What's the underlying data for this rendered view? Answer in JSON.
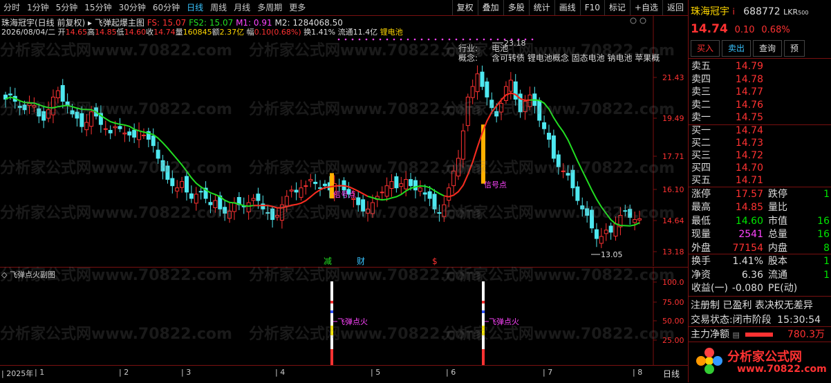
{
  "toolbar": {
    "periods": [
      "分时",
      "1分钟",
      "5分钟",
      "15分钟",
      "30分钟",
      "60分钟",
      "日线",
      "周线",
      "月线",
      "多周期",
      "更多"
    ],
    "active": "日线",
    "right_buttons": [
      "复权",
      "叠加",
      "多股",
      "统计",
      "画线",
      "F10",
      "标记",
      "+自选",
      "返回"
    ]
  },
  "title": {
    "stock": "珠海冠宇(日线 前复权)",
    "indicator": "飞弹起爆主图",
    "fs": "FS: 15.07",
    "fs2": "FS2: 15.07",
    "m1": "M1: 0.91",
    "m2": "M2: 1284068.50"
  },
  "info": {
    "date": "2026/08/04/二",
    "open_label": "开",
    "open": "14.65",
    "high_label": "高",
    "high": "14.85",
    "low_label": "低",
    "low": "14.60",
    "close_label": "收",
    "close": "14.74",
    "vol_label": "量",
    "vol": "160845",
    "amount_label": "额",
    "amount": "2.37亿",
    "change_label": "幅",
    "change": "0.10(0.68%)",
    "turnover": "换1.41%",
    "float": "流通11.4亿",
    "concept": "锂电池"
  },
  "industry": {
    "label1": "行业:",
    "value1": "电池",
    "label2": "概念:",
    "value2": "含可转债 锂电池概念 固态电池 钠电池 苹果概"
  },
  "annotations": {
    "high_price": "23.18",
    "low_price": "13.05",
    "signal1": "信号点",
    "signal2": "信号点",
    "reduce": "减",
    "finance": "财",
    "dollar": "$"
  },
  "y_axis_main": [
    "21.43",
    "19.49",
    "17.71",
    "16.10",
    "14.64",
    "13.18"
  ],
  "sub": {
    "title": "飞弹点火副图",
    "label1": "飞弹点火",
    "label2": "飞弹点火",
    "y_axis": [
      "100.0",
      "75.00",
      "50.00",
      "25.00"
    ]
  },
  "x_axis": {
    "ticks": [
      "2025年",
      "1",
      "2",
      "3",
      "4",
      "5",
      "6",
      "7",
      "8"
    ],
    "period": "日线"
  },
  "watermark": "分析家公式网www.70822.com",
  "logo": {
    "name": "分析家公式网",
    "url": "www.70822.com"
  },
  "quote": {
    "name": "珠海冠宇",
    "code": "688772",
    "tag": "LKR",
    "tag2": "500",
    "price": "14.74",
    "change": "0.10",
    "pct": "0.68%",
    "buttons": [
      "买入",
      "卖出",
      "查询",
      "预"
    ],
    "asks": [
      {
        "label": "卖五",
        "price": "14.79"
      },
      {
        "label": "卖四",
        "price": "14.78"
      },
      {
        "label": "卖三",
        "price": "14.77"
      },
      {
        "label": "卖二",
        "price": "14.76"
      },
      {
        "label": "卖一",
        "price": "14.75"
      }
    ],
    "bids": [
      {
        "label": "买一",
        "price": "14.74"
      },
      {
        "label": "买二",
        "price": "14.73"
      },
      {
        "label": "买三",
        "price": "14.72"
      },
      {
        "label": "买四",
        "price": "14.70"
      },
      {
        "label": "买五",
        "price": "14.71"
      }
    ],
    "stats": [
      {
        "l1": "涨停",
        "v1": "17.57",
        "l2": "跌停",
        "v2": "1"
      },
      {
        "l1": "最高",
        "v1": "14.85",
        "l2": "量比",
        "v2": ""
      },
      {
        "l1": "最低",
        "v1": "14.60",
        "l2": "市值",
        "v2": "16"
      },
      {
        "l1": "现量",
        "v1": "2541",
        "l2": "总量",
        "v2": "16"
      },
      {
        "l1": "外盘",
        "v1": "77154",
        "l2": "内盘",
        "v2": "8"
      }
    ],
    "fin": [
      {
        "l1": "换手",
        "v1": "1.41%",
        "l2": "股本",
        "v2": "1"
      },
      {
        "l1": "净资",
        "v1": "6.36",
        "l2": "流通",
        "v2": "1"
      },
      {
        "l1": "收益(一)",
        "v1": "-0.080",
        "l2": "PE(动)",
        "v2": ""
      }
    ],
    "notes": "注册制 已盈利 表决权无差异",
    "trade_status_label": "交易状态:",
    "trade_status": "闭市阶段",
    "time": "15:30:54",
    "main_flow_label": "主力净额",
    "main_flow": "780.3万"
  },
  "colors": {
    "up": "#ff3232",
    "down": "#4ee8f0",
    "ma_green": "#22dd22",
    "ma_red": "#ff2020",
    "signal": "#ffb000"
  }
}
